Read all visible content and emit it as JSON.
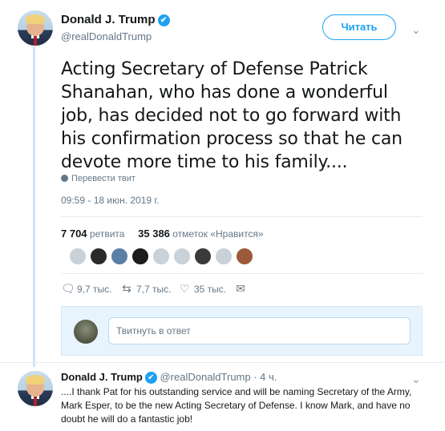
{
  "tweet": {
    "author_name": "Donald J. Trump",
    "verified_mark": "✔",
    "handle": "@realDonaldTrump",
    "follow_label": "Читать",
    "text": "Acting Secretary of Defense Patrick Shanahan, who has done a wonderful job, has decided not to go forward with his confirmation process so that he can devote more time to his family....",
    "translate_label": "Перевести твит",
    "timestamp": "09:59 - 18 июн. 2019 г.",
    "retweets_count": "7 704",
    "retweets_label": "ретвита",
    "likes_count": "35 386",
    "likes_label": "отметок «Нравится»",
    "reply_count": "9,7 тыс.",
    "retweet_count_short": "7,7 тыс.",
    "like_count_short": "35 тыс.",
    "icons": {
      "reply": "reply-icon",
      "retweet": "retweet-icon",
      "like": "heart-icon",
      "message": "envelope-icon",
      "caret": "chevron-down-icon",
      "globe": "globe-icon"
    }
  },
  "compose": {
    "placeholder": "Твитнуть в ответ"
  },
  "reply": {
    "author_name": "Donald J. Trump",
    "verified_mark": "✔",
    "handle_time": "@realDonaldTrump · 4 ч.",
    "text": "....I thank Pat for his outstanding service and will be naming Secretary of the Army, Mark Esper, to be the new Acting Secretary of Defense. I know Mark, and have no doubt he will do a fantastic job!"
  },
  "colors": {
    "accent": "#1da1f2",
    "muted": "#657786",
    "thread_line": "#cde4f7"
  }
}
